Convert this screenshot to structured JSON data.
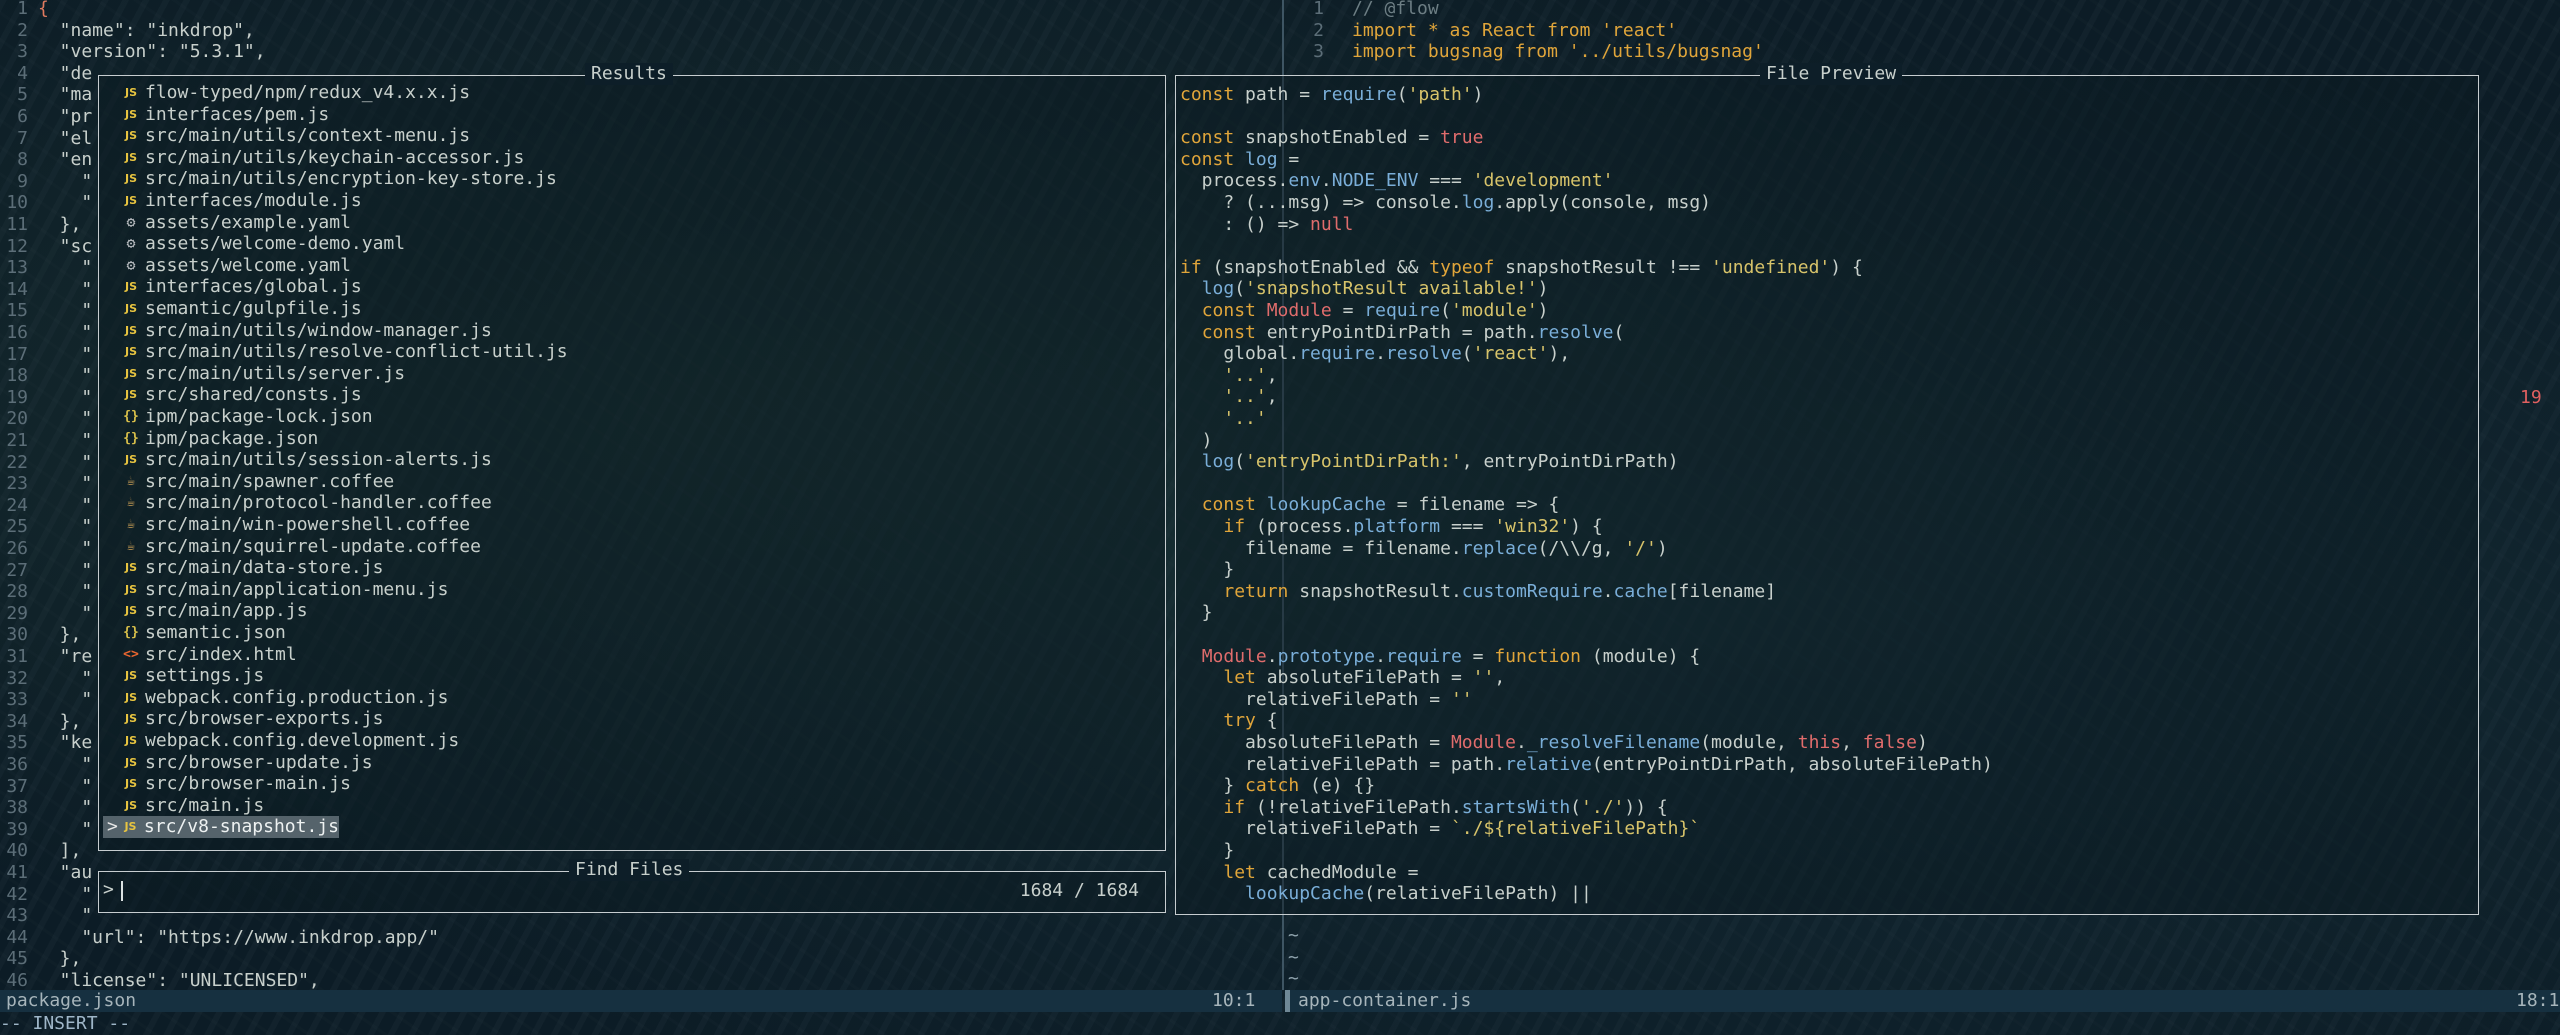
{
  "left_editor": {
    "lines": [
      {
        "n": "1",
        "t": "{"
      },
      {
        "n": "2",
        "t": "  \"name\": \"inkdrop\","
      },
      {
        "n": "3",
        "t": "  \"version\": \"5.3.1\","
      },
      {
        "n": "4",
        "t": "  \"de"
      },
      {
        "n": "5",
        "t": "  \"ma"
      },
      {
        "n": "6",
        "t": "  \"pr"
      },
      {
        "n": "7",
        "t": "  \"el"
      },
      {
        "n": "8",
        "t": "  \"en"
      },
      {
        "n": "9",
        "t": "    \""
      },
      {
        "n": "10",
        "t": "    \""
      },
      {
        "n": "11",
        "t": "  },"
      },
      {
        "n": "12",
        "t": "  \"sc"
      },
      {
        "n": "13",
        "t": "    \""
      },
      {
        "n": "14",
        "t": "    \""
      },
      {
        "n": "15",
        "t": "    \""
      },
      {
        "n": "16",
        "t": "    \""
      },
      {
        "n": "17",
        "t": "    \""
      },
      {
        "n": "18",
        "t": "    \""
      },
      {
        "n": "19",
        "t": "    \""
      },
      {
        "n": "20",
        "t": "    \""
      },
      {
        "n": "21",
        "t": "    \""
      },
      {
        "n": "22",
        "t": "    \""
      },
      {
        "n": "23",
        "t": "    \""
      },
      {
        "n": "24",
        "t": "    \""
      },
      {
        "n": "25",
        "t": "    \""
      },
      {
        "n": "26",
        "t": "    \""
      },
      {
        "n": "27",
        "t": "    \""
      },
      {
        "n": "28",
        "t": "    \""
      },
      {
        "n": "29",
        "t": "    \""
      },
      {
        "n": "30",
        "t": "  },"
      },
      {
        "n": "31",
        "t": "  \"re"
      },
      {
        "n": "32",
        "t": "    \""
      },
      {
        "n": "33",
        "t": "    \""
      },
      {
        "n": "34",
        "t": "  },"
      },
      {
        "n": "35",
        "t": "  \"ke"
      },
      {
        "n": "36",
        "t": "    \""
      },
      {
        "n": "37",
        "t": "    \""
      },
      {
        "n": "38",
        "t": "    \""
      },
      {
        "n": "39",
        "t": "    \""
      },
      {
        "n": "40",
        "t": "  ],"
      },
      {
        "n": "41",
        "t": "  \"au"
      },
      {
        "n": "42",
        "t": "    \""
      },
      {
        "n": "43",
        "t": "    \""
      },
      {
        "n": "44",
        "t": "    \"url\": \"https://www.inkdrop.app/\""
      },
      {
        "n": "45",
        "t": "  },"
      },
      {
        "n": "46",
        "t": "  \"license\": \"UNLICENSED\","
      }
    ]
  },
  "right_editor": {
    "lines": [
      {
        "n": "1",
        "t": "// @flow"
      },
      {
        "n": "2",
        "t": "import * as React from 'react'"
      },
      {
        "n": "3",
        "t": "import bugsnag from '../utils/bugsnag'"
      }
    ],
    "tildes": [
      "~",
      "~",
      "~"
    ],
    "side_number": "19"
  },
  "results": {
    "title": "Results",
    "items": [
      {
        "icon": "js",
        "label": "flow-typed/npm/redux_v4.x.x.js"
      },
      {
        "icon": "js",
        "label": "interfaces/pem.js"
      },
      {
        "icon": "js",
        "label": "src/main/utils/context-menu.js"
      },
      {
        "icon": "js",
        "label": "src/main/utils/keychain-accessor.js"
      },
      {
        "icon": "js",
        "label": "src/main/utils/encryption-key-store.js"
      },
      {
        "icon": "js",
        "label": "interfaces/module.js"
      },
      {
        "icon": "gear",
        "label": "assets/example.yaml"
      },
      {
        "icon": "gear",
        "label": "assets/welcome-demo.yaml"
      },
      {
        "icon": "gear",
        "label": "assets/welcome.yaml"
      },
      {
        "icon": "js",
        "label": "interfaces/global.js"
      },
      {
        "icon": "js",
        "label": "semantic/gulpfile.js"
      },
      {
        "icon": "js",
        "label": "src/main/utils/window-manager.js"
      },
      {
        "icon": "js",
        "label": "src/main/utils/resolve-conflict-util.js"
      },
      {
        "icon": "js",
        "label": "src/main/utils/server.js"
      },
      {
        "icon": "js",
        "label": "src/shared/consts.js"
      },
      {
        "icon": "json",
        "label": "ipm/package-lock.json"
      },
      {
        "icon": "json",
        "label": "ipm/package.json"
      },
      {
        "icon": "js",
        "label": "src/main/utils/session-alerts.js"
      },
      {
        "icon": "coffee",
        "label": "src/main/spawner.coffee"
      },
      {
        "icon": "coffee",
        "label": "src/main/protocol-handler.coffee"
      },
      {
        "icon": "coffee",
        "label": "src/main/win-powershell.coffee"
      },
      {
        "icon": "coffee",
        "label": "src/main/squirrel-update.coffee"
      },
      {
        "icon": "js",
        "label": "src/main/data-store.js"
      },
      {
        "icon": "js",
        "label": "src/main/application-menu.js"
      },
      {
        "icon": "js",
        "label": "src/main/app.js"
      },
      {
        "icon": "json",
        "label": "semantic.json"
      },
      {
        "icon": "html",
        "label": "src/index.html"
      },
      {
        "icon": "js",
        "label": "settings.js"
      },
      {
        "icon": "js",
        "label": "webpack.config.production.js"
      },
      {
        "icon": "js",
        "label": "src/browser-exports.js"
      },
      {
        "icon": "js",
        "label": "webpack.config.development.js"
      },
      {
        "icon": "js",
        "label": "src/browser-update.js"
      },
      {
        "icon": "js",
        "label": "src/browser-main.js"
      },
      {
        "icon": "js",
        "label": "src/main.js"
      },
      {
        "icon": "js",
        "label": "src/v8-snapshot.js",
        "selected": true
      }
    ],
    "caret": ">"
  },
  "preview": {
    "title": "File Preview",
    "lines": [
      "const path = require('path')",
      "",
      "const snapshotEnabled = true",
      "const log =",
      "  process.env.NODE_ENV === 'development'",
      "    ? (...msg) => console.log.apply(console, msg)",
      "    : () => null",
      "",
      "if (snapshotEnabled && typeof snapshotResult !== 'undefined') {",
      "  log('snapshotResult available!')",
      "  const Module = require('module')",
      "  const entryPointDirPath = path.resolve(",
      "    global.require.resolve('react'),",
      "    '..',",
      "    '..',",
      "    '..'",
      "  )",
      "  log('entryPointDirPath:', entryPointDirPath)",
      "",
      "  const lookupCache = filename => {",
      "    if (process.platform === 'win32') {",
      "      filename = filename.replace(/\\\\/g, '/')",
      "    }",
      "    return snapshotResult.customRequire.cache[filename]",
      "  }",
      "",
      "  Module.prototype.require = function (module) {",
      "    let absoluteFilePath = '',",
      "      relativeFilePath = ''",
      "    try {",
      "      absoluteFilePath = Module._resolveFilename(module, this, false)",
      "      relativeFilePath = path.relative(entryPointDirPath, absoluteFilePath)",
      "    } catch (e) {}",
      "    if (!relativeFilePath.startsWith('./')) {",
      "      relativeFilePath = `./${relativeFilePath}`",
      "    }",
      "    let cachedModule =",
      "      lookupCache(relativeFilePath) ||"
    ]
  },
  "find": {
    "title": "Find Files",
    "prompt": ">",
    "count": "1684 / 1684"
  },
  "status": {
    "left_file": "package.json",
    "left_pos": "10:1",
    "right_file": "app-container.js",
    "right_pos": "18:1",
    "mode": "-- INSERT --"
  }
}
